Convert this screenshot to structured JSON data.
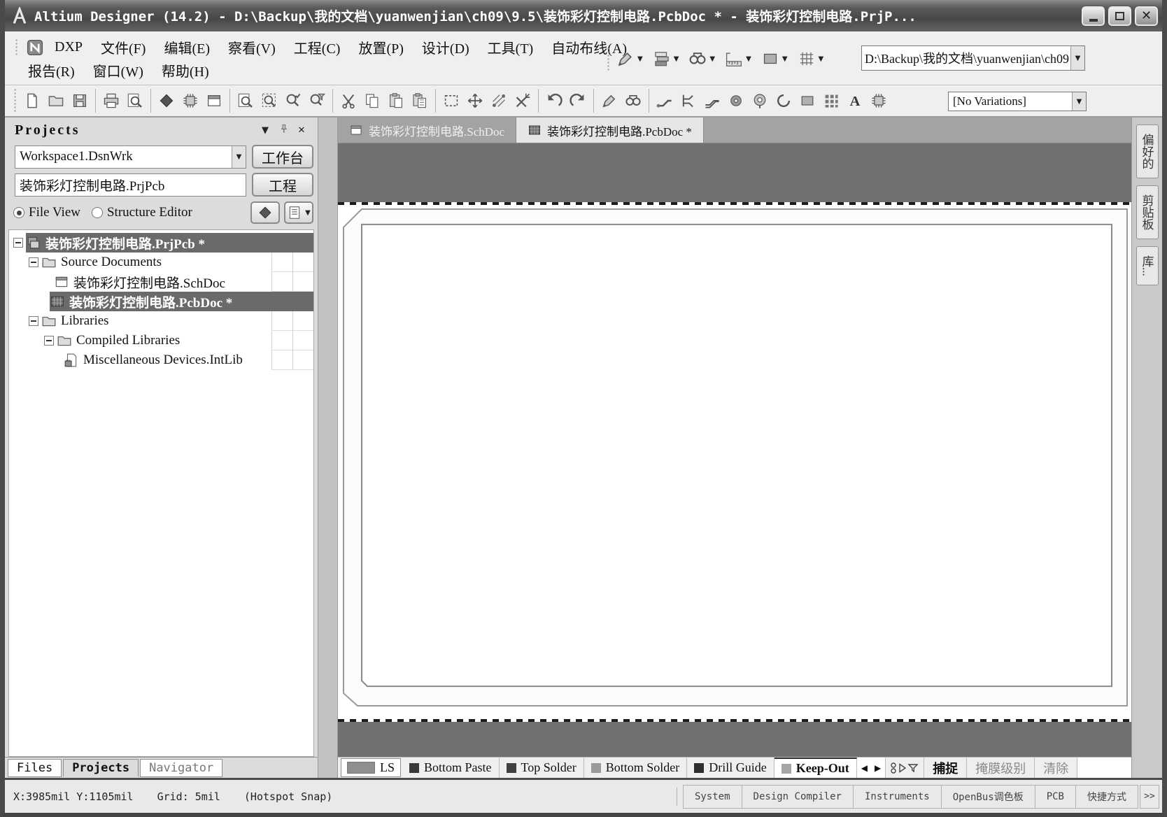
{
  "colors": {
    "titlebar": "#4a4a4a",
    "selection": "#6a6a6a",
    "canvas_margin": "#707070",
    "panel_bg": "#dcdcdc",
    "toolbar_bg": "#efefef"
  },
  "window": {
    "title": "Altium Designer (14.2) - D:\\Backup\\我的文档\\yuanwenjian\\ch09\\9.5\\装饰彩灯控制电路.PcbDoc * - 装饰彩灯控制电路.PrjP...",
    "controls": [
      "minimize",
      "maximize",
      "close"
    ]
  },
  "menu": {
    "dxp": "DXP",
    "row1": [
      "文件(F)",
      "编辑(E)",
      "察看(V)",
      "工程(C)",
      "放置(P)",
      "设计(D)",
      "工具(T)",
      "自动布线(A)"
    ],
    "row2": [
      "报告(R)",
      "窗口(W)",
      "帮助(H)"
    ],
    "path_value": "D:\\Backup\\我的文档\\yuanwenjian\\ch09",
    "tool_icons": [
      "board-insight",
      "layer-stack",
      "find",
      "measure",
      "room",
      "grid-settings"
    ]
  },
  "toolbar": {
    "icons": [
      "new-document",
      "open-document",
      "save-document",
      "print",
      "print-preview",
      "devices-view",
      "pcb-board",
      "workspace-panels",
      "fit-document",
      "fit-area",
      "zoom-selected",
      "filter-zoom",
      "cut",
      "copy",
      "paste",
      "paste-array",
      "select-area",
      "move-selection",
      "align-objects",
      "cross-probe",
      "undo",
      "redo",
      "place-line",
      "find-similar",
      "interactive-routing",
      "fanout",
      "diff-pair-routing",
      "place-pad",
      "place-via",
      "place-arc",
      "place-fill",
      "pad-array",
      "place-string",
      "place-component"
    ],
    "variations": "[No Variations]"
  },
  "projects_panel": {
    "title": "Projects",
    "header_icons": [
      "chevron-down",
      "pin",
      "close"
    ],
    "workspace": "Workspace1.DsnWrk",
    "workspace_button": "工作台",
    "project": "装饰彩灯控制电路.PrjPcb",
    "project_button": "工程",
    "file_view": "File View",
    "structure_editor": "Structure Editor",
    "tree": [
      {
        "label": "装饰彩灯控制电路.PrjPcb *",
        "selected": true
      },
      {
        "label": "Source Documents"
      },
      {
        "label": "装饰彩灯控制电路.SchDoc"
      },
      {
        "label": "装饰彩灯控制电路.PcbDoc *",
        "selected": true
      },
      {
        "label": "Libraries"
      },
      {
        "label": "Compiled Libraries"
      },
      {
        "label": "Miscellaneous Devices.IntLib"
      }
    ],
    "bottom_tabs": [
      "Files",
      "Projects",
      "Navigator"
    ]
  },
  "doc_tabs": {
    "schdoc": "装饰彩灯控制电路.SchDoc",
    "pcbdoc": "装饰彩灯控制电路.PcbDoc *"
  },
  "layer_bar": {
    "ls": {
      "label": "LS",
      "swatch": "#8f8f8f"
    },
    "tabs": [
      {
        "label": "Bottom Paste",
        "swatch": "#3a3a3a"
      },
      {
        "label": "Top Solder",
        "swatch": "#404040"
      },
      {
        "label": "Bottom Solder",
        "swatch": "#9a9a9a"
      },
      {
        "label": "Drill Guide",
        "swatch": "#2f2f2f"
      },
      {
        "label": "Keep-Out",
        "swatch": "#a5a5a5",
        "active": true
      }
    ],
    "snap": "捕捉",
    "mask_level": "掩膜级别",
    "clear": "清除"
  },
  "right_tabs": [
    "偏好的",
    "剪贴板",
    "库..."
  ],
  "status_bar": {
    "coords": "X:3985mil Y:1105mil",
    "grid": "Grid: 5mil",
    "snap": "(Hotspot Snap)",
    "panels": [
      "System",
      "Design Compiler",
      "Instruments",
      "OpenBus调色板",
      "PCB",
      "快捷方式"
    ],
    "more": ">>"
  }
}
